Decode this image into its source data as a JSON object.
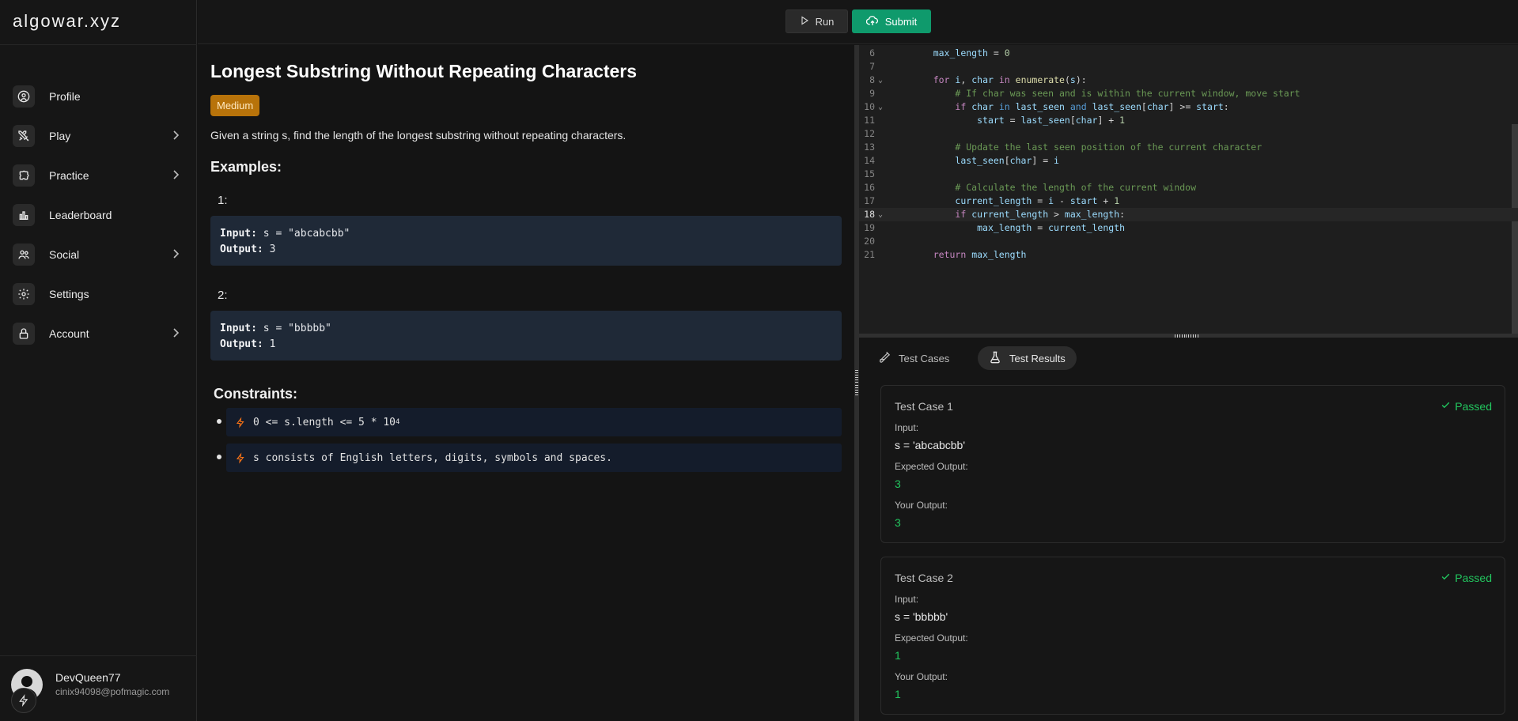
{
  "app": {
    "logo": "algowar.xyz"
  },
  "sidebar": {
    "items": [
      {
        "label": "Profile",
        "icon": "user-circle-icon",
        "has_chevron": false
      },
      {
        "label": "Play",
        "icon": "swords-icon",
        "has_chevron": true
      },
      {
        "label": "Practice",
        "icon": "puzzle-icon",
        "has_chevron": true
      },
      {
        "label": "Leaderboard",
        "icon": "bar-chart-icon",
        "has_chevron": false
      },
      {
        "label": "Social",
        "icon": "users-icon",
        "has_chevron": true
      },
      {
        "label": "Settings",
        "icon": "gear-icon",
        "has_chevron": false
      },
      {
        "label": "Account",
        "icon": "lock-icon",
        "has_chevron": true
      }
    ],
    "user": {
      "name": "DevQueen77",
      "email": "cinix94098@pofmagic.com"
    }
  },
  "toolbar": {
    "run_label": "Run",
    "submit_label": "Submit",
    "submit_color": "#0f9a6c"
  },
  "problem": {
    "title": "Longest Substring Without Repeating Characters",
    "difficulty": "Medium",
    "difficulty_color": "#b8730a",
    "description": "Given a string s, find the length of the longest substring without repeating characters.",
    "examples_heading": "Examples:",
    "examples": [
      {
        "num": "1:",
        "input_label": "Input:",
        "input": " s = \"abcabcbb\"",
        "output_label": "Output:",
        "output": " 3"
      },
      {
        "num": "2:",
        "input_label": "Input:",
        "input": " s = \"bbbbb\"",
        "output_label": "Output:",
        "output": " 1"
      }
    ],
    "constraints_heading": "Constraints:",
    "constraints": [
      {
        "text": "0 <= s.length <= 5 * 10",
        "sup": "4"
      },
      {
        "text": "s consists of English letters, digits, symbols and spaces.",
        "sup": ""
      }
    ]
  },
  "editor": {
    "active_line": "18",
    "lines": [
      {
        "n": "6",
        "fold": "",
        "html": "    <span class='vr'>max_length</span> = <span class='nm'>0</span>"
      },
      {
        "n": "7",
        "fold": "",
        "html": ""
      },
      {
        "n": "8",
        "fold": "v",
        "html": "    <span class='kw'>for</span> <span class='vr'>i</span>, <span class='vr'>char</span> <span class='kw'>in</span> <span class='bi'>enumerate</span>(<span class='vr'>s</span>):"
      },
      {
        "n": "9",
        "fold": "",
        "html": "        <span class='cm'># If char was seen and is within the current window, move start</span>"
      },
      {
        "n": "10",
        "fold": "v",
        "html": "        <span class='kw'>if</span> <span class='vr'>char</span> <span class='kb'>in</span> <span class='vr'>last_seen</span> <span class='kb'>and</span> <span class='vr'>last_seen</span>[<span class='vr'>char</span>] &gt;= <span class='vr'>start</span>:"
      },
      {
        "n": "11",
        "fold": "",
        "html": "            <span class='vr'>start</span> = <span class='vr'>last_seen</span>[<span class='vr'>char</span>] + <span class='nm'>1</span>"
      },
      {
        "n": "12",
        "fold": "",
        "html": ""
      },
      {
        "n": "13",
        "fold": "",
        "html": "        <span class='cm'># Update the last seen position of the current character</span>"
      },
      {
        "n": "14",
        "fold": "",
        "html": "        <span class='vr'>last_seen</span>[<span class='vr'>char</span>] = <span class='vr'>i</span>"
      },
      {
        "n": "15",
        "fold": "",
        "html": ""
      },
      {
        "n": "16",
        "fold": "",
        "html": "        <span class='cm'># Calculate the length of the current window</span>"
      },
      {
        "n": "17",
        "fold": "",
        "html": "        <span class='vr'>current_length</span> = <span class='vr'>i</span> - <span class='vr'>start</span> + <span class='nm'>1</span>"
      },
      {
        "n": "18",
        "fold": "v",
        "html": "        <span class='kw'>if</span> <span class='vr'>current_length</span> &gt; <span class='vr'>max_length</span>:"
      },
      {
        "n": "19",
        "fold": "",
        "html": "            <span class='vr'>max_length</span> = <span class='vr'>current_length</span>"
      },
      {
        "n": "20",
        "fold": "",
        "html": ""
      },
      {
        "n": "21",
        "fold": "",
        "html": "    <span class='kw'>return</span> <span class='vr'>max_length</span>"
      }
    ]
  },
  "results": {
    "tabs": [
      {
        "label": "Test Cases",
        "icon": "test-tube-diagonal-icon",
        "active": false
      },
      {
        "label": "Test Results",
        "icon": "flask-icon",
        "active": true
      }
    ],
    "cases": [
      {
        "title": "Test Case 1",
        "status": "Passed",
        "input_label": "Input:",
        "input": "s = 'abcabcbb'",
        "expected_label": "Expected Output:",
        "expected": "3",
        "your_label": "Your Output:",
        "yours": "3"
      },
      {
        "title": "Test Case 2",
        "status": "Passed",
        "input_label": "Input:",
        "input": "s = 'bbbbb'",
        "expected_label": "Expected Output:",
        "expected": "1",
        "your_label": "Your Output:",
        "yours": "1"
      }
    ]
  }
}
